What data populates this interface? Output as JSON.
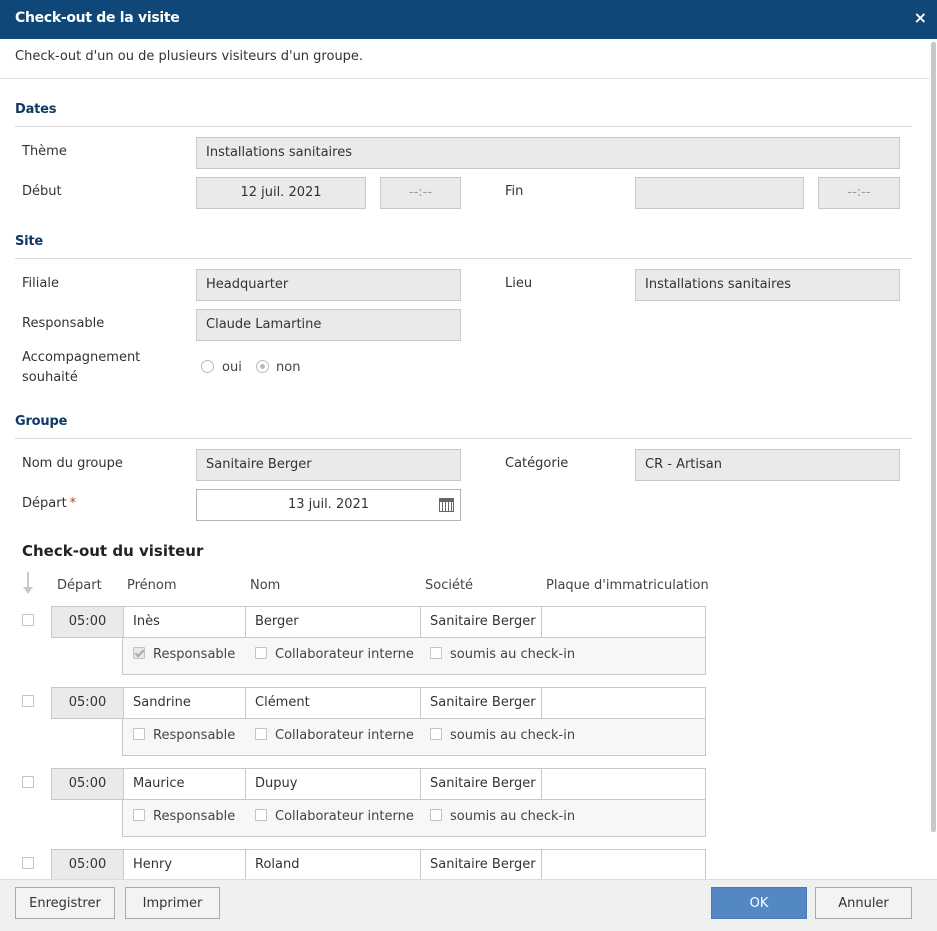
{
  "window": {
    "title": "Check-out de la visite",
    "close_label": "×"
  },
  "description": "Check-out d'un ou de plusieurs visiteurs d'un groupe.",
  "sections": {
    "dates": "Dates",
    "site": "Site",
    "group": "Groupe"
  },
  "dates": {
    "theme_label": "Thème",
    "theme_value": "Installations sanitaires",
    "start_label": "Début",
    "start_date": "12 juil. 2021",
    "start_time": "--:--",
    "end_label": "Fin",
    "end_date": "",
    "end_time": "--:--"
  },
  "site": {
    "branch_label": "Filiale",
    "branch_value": "Headquarter",
    "place_label": "Lieu",
    "place_value": "Installations sanitaires",
    "responsible_label": "Responsable",
    "responsible_value": "Claude Lamartine",
    "escort_label_line1": "Accompagnement",
    "escort_label_line2": "souhaité",
    "escort_yes": "oui",
    "escort_no": "non",
    "escort_selected": "non"
  },
  "group": {
    "name_label": "Nom du groupe",
    "name_value": "Sanitaire Berger",
    "category_label": "Catégorie",
    "category_value": "CR - Artisan",
    "departure_label": "Départ",
    "departure_required": "*",
    "departure_value": "13 juil. 2021"
  },
  "checkout": {
    "heading": "Check-out du visiteur",
    "columns": {
      "departure": "Départ",
      "firstname": "Prénom",
      "lastname": "Nom",
      "company": "Société",
      "plate": "Plaque d'immatriculation"
    },
    "option_labels": {
      "responsible": "Responsable",
      "internal": "Collaborateur interne",
      "checkin": "soumis au check-in"
    },
    "visitors": [
      {
        "time": "05:00",
        "firstname": "Inès",
        "lastname": "Berger",
        "company": "Sanitaire Berger",
        "plate": "",
        "responsible": true,
        "internal": false,
        "checkin": false
      },
      {
        "time": "05:00",
        "firstname": "Sandrine",
        "lastname": "Clément",
        "company": "Sanitaire Berger",
        "plate": "",
        "responsible": false,
        "internal": false,
        "checkin": false
      },
      {
        "time": "05:00",
        "firstname": "Maurice",
        "lastname": "Dupuy",
        "company": "Sanitaire Berger",
        "plate": "",
        "responsible": false,
        "internal": false,
        "checkin": false
      },
      {
        "time": "05:00",
        "firstname": "Henry",
        "lastname": "Roland",
        "company": "Sanitaire Berger",
        "plate": ""
      }
    ]
  },
  "footer": {
    "save": "Enregistrer",
    "print": "Imprimer",
    "ok": "OK",
    "cancel": "Annuler"
  },
  "colors": {
    "titlebar": "#0f4778",
    "section": "#0f3a66",
    "primary_button": "#5488c4",
    "required": "#c0392b"
  }
}
